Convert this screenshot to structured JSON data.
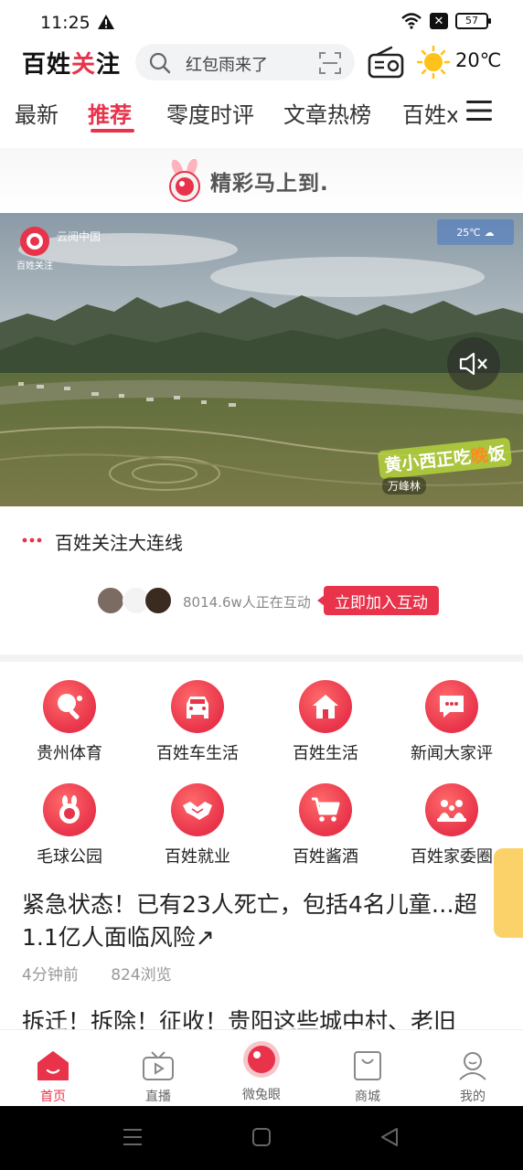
{
  "status_bar": {
    "time": "11:25",
    "battery": "57"
  },
  "header": {
    "logo_part1": "百姓",
    "logo_part2": "关",
    "logo_part3": "注",
    "search_placeholder": "红包雨来了",
    "temperature": "20℃"
  },
  "tabs": [
    {
      "label": "最新"
    },
    {
      "label": "推荐"
    },
    {
      "label": "零度时评"
    },
    {
      "label": "文章热榜"
    },
    {
      "label": "百姓x"
    }
  ],
  "banner": {
    "text": "精彩马上到."
  },
  "video": {
    "watermark": "云阅中国",
    "logo_text": "百姓关注",
    "weather_temp": "25℃",
    "caption_a": "黄小西正吃",
    "caption_b": "晚",
    "caption_c": "饭",
    "caption_sub": "万峰林"
  },
  "live": {
    "title": "百姓关注大连线",
    "interaction_count": "8014.6w人正在互动",
    "join_label": "立即加入互动"
  },
  "categories": [
    {
      "label": "贵州体育",
      "icon": "pingpong-icon"
    },
    {
      "label": "百姓车生活",
      "icon": "car-icon"
    },
    {
      "label": "百姓生活",
      "icon": "home-icon"
    },
    {
      "label": "新闻大家评",
      "icon": "comment-icon"
    },
    {
      "label": "毛球公园",
      "icon": "rabbit-icon"
    },
    {
      "label": "百姓就业",
      "icon": "handshake-icon"
    },
    {
      "label": "百姓酱酒",
      "icon": "cart-icon"
    },
    {
      "label": "百姓家委圈",
      "icon": "family-icon"
    }
  ],
  "news": [
    {
      "title": "紧急状态！已有23人死亡，包括4名儿童…超1.1亿人面临风险↗",
      "time": "4分钟前",
      "views": "824浏览"
    },
    {
      "title": "拆迁！拆除！征收！贵阳这些城中村、老旧"
    }
  ],
  "bottom_nav": [
    {
      "label": "首页"
    },
    {
      "label": "直播"
    },
    {
      "label": "微兔眼"
    },
    {
      "label": "商城"
    },
    {
      "label": "我的"
    }
  ],
  "colors": {
    "accent": "#e8334a"
  }
}
